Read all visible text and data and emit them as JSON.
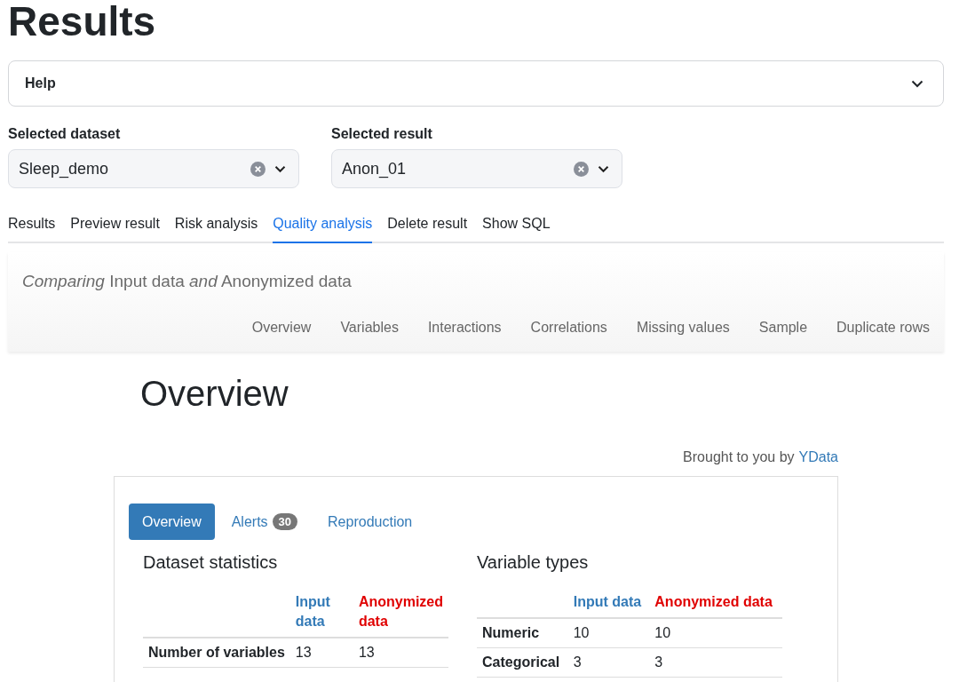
{
  "title": "Results",
  "help": {
    "label": "Help",
    "expanded": false
  },
  "selects": [
    {
      "label": "Selected dataset",
      "value": "Sleep_demo"
    },
    {
      "label": "Selected result",
      "value": "Anon_01"
    }
  ],
  "tabs": [
    {
      "label": "Results",
      "selected": false
    },
    {
      "label": "Preview result",
      "selected": false
    },
    {
      "label": "Risk analysis",
      "selected": false
    },
    {
      "label": "Quality analysis",
      "selected": true
    },
    {
      "label": "Delete result",
      "selected": false
    },
    {
      "label": "Show SQL",
      "selected": false
    }
  ],
  "report": {
    "subtitle": "*Comparing* Input data *and* Anonymized data",
    "nav": [
      "Overview",
      "Variables",
      "Interactions",
      "Correlations",
      "Missing values",
      "Sample",
      "Duplicate rows"
    ],
    "heading": "Overview",
    "credit": {
      "text": "Brought to you by",
      "link": "YData"
    },
    "pills": [
      {
        "label": "Overview",
        "selected": true
      },
      {
        "label": "Alerts",
        "badge": "30",
        "selected": false
      },
      {
        "label": "Reproduction",
        "selected": false
      }
    ],
    "tables": [
      {
        "title": "Dataset statistics",
        "columns": [
          {
            "label": "Input data",
            "color": "#337ab7"
          },
          {
            "label": "Anonymized data",
            "color": "#e00000"
          }
        ],
        "rows": [
          {
            "name": "Number of variables",
            "values": [
              "13",
              "13"
            ]
          }
        ]
      },
      {
        "title": "Variable types",
        "columns": [
          {
            "label": "Input data",
            "color": "#337ab7"
          },
          {
            "label": "Anonymized data",
            "color": "#e00000"
          }
        ],
        "rows": [
          {
            "name": "Numeric",
            "values": [
              "10",
              "10"
            ]
          },
          {
            "name": "Categorical",
            "values": [
              "3",
              "3"
            ]
          }
        ]
      }
    ]
  }
}
